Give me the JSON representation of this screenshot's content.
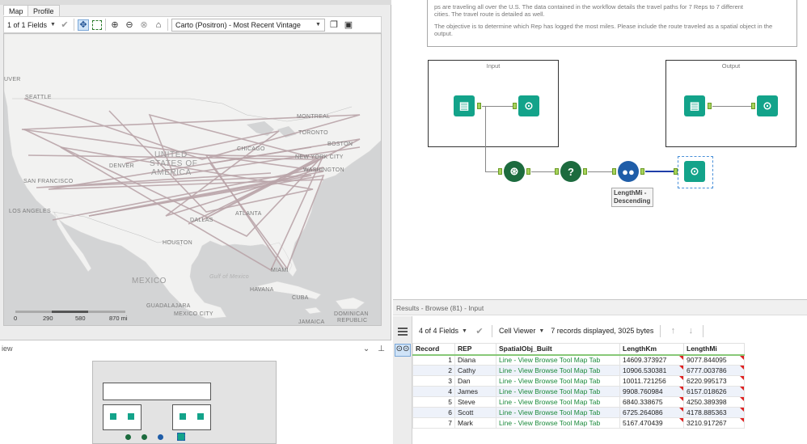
{
  "map_panel": {
    "tabs": [
      {
        "label": "Map",
        "active": true
      },
      {
        "label": "Profile",
        "active": false
      }
    ],
    "fields_dropdown": "1 of 1 Fields",
    "basemap_dropdown": "Carto (Positron) - Most Recent Vintage",
    "labels": {
      "vancouver": "UVER",
      "seattle": "SEATTLE",
      "montreal": "MONTREAL",
      "toronto": "TORONTO",
      "boston": "BOSTON",
      "chicago": "CHICAGO",
      "newyork": "NEW YORK CITY",
      "washington": "WASHINGTON",
      "denver": "DENVER",
      "united": "UNITED",
      "states_of": "STATES OF",
      "america": "AMERICA",
      "sanfrancisco": "SAN FRANCISCO",
      "losangeles": "LOS ANGELES",
      "dallas": "DALLAS",
      "atlanta": "ATLANTA",
      "houston": "HOUSTON",
      "gulf": "Gulf of Mexico",
      "miami": "MIAMI",
      "havana": "HAVANA",
      "cuba": "CUBA",
      "mexico": "MEXICO",
      "guadalajara": "GUADALAJARA",
      "mexicocity": "MEXICO CITY",
      "dominican": "DOMINICAN",
      "republic": "REPUBLIC",
      "jamaica": "JAMAICA"
    },
    "scale": {
      "t0": "0",
      "t1": "290",
      "t2": "580",
      "t3": "870 mi"
    }
  },
  "overview": {
    "title": "iew",
    "pin_icon": "pin-icon"
  },
  "workflow": {
    "comment_line1": "ps are traveling all over the U.S. The data contained in the workflow details the travel paths for 7 Reps to 7 different",
    "comment_line2": "cities. The travel route is detailed as well.",
    "comment_line3": "The objective is to determine which Rep has logged the most miles. Please include the route traveled as a spatial object in the",
    "comment_line4": "output.",
    "input_container": "Input",
    "output_container": "Output",
    "sort_annotation": "LengthMi - Descending"
  },
  "results": {
    "header": "Results - Browse (81) - Input",
    "fields_dropdown": "4 of 4 Fields",
    "view_dropdown": "Cell Viewer",
    "summary": "7 records displayed, 3025 bytes",
    "columns": [
      "Record",
      "REP",
      "SpatialObj_Built",
      "LengthKm",
      "LengthMi"
    ],
    "rows": [
      {
        "record": "1",
        "rep": "Diana",
        "spatial": "Line - View Browse Tool Map Tab",
        "km": "14609.373927",
        "mi": "9077.844095"
      },
      {
        "record": "2",
        "rep": "Cathy",
        "spatial": "Line - View Browse Tool Map Tab",
        "km": "10906.530381",
        "mi": "6777.003786"
      },
      {
        "record": "3",
        "rep": "Dan",
        "spatial": "Line - View Browse Tool Map Tab",
        "km": "10011.721256",
        "mi": "6220.995173"
      },
      {
        "record": "4",
        "rep": "James",
        "spatial": "Line - View Browse Tool Map Tab",
        "km": "9908.760984",
        "mi": "6157.018626"
      },
      {
        "record": "5",
        "rep": "Steve",
        "spatial": "Line - View Browse Tool Map Tab",
        "km": "6840.338675",
        "mi": "4250.389398"
      },
      {
        "record": "6",
        "rep": "Scott",
        "spatial": "Line - View Browse Tool Map Tab",
        "km": "6725.264086",
        "mi": "4178.885363"
      },
      {
        "record": "7",
        "rep": "Mark",
        "spatial": "Line - View Browse Tool Map Tab",
        "km": "5167.470439",
        "mi": "3210.917267"
      }
    ]
  },
  "colors": {
    "route": "#b9a4a8",
    "tool_green": "#13a38a",
    "tool_blue": "#1f5da8",
    "flag": "#e02020"
  }
}
